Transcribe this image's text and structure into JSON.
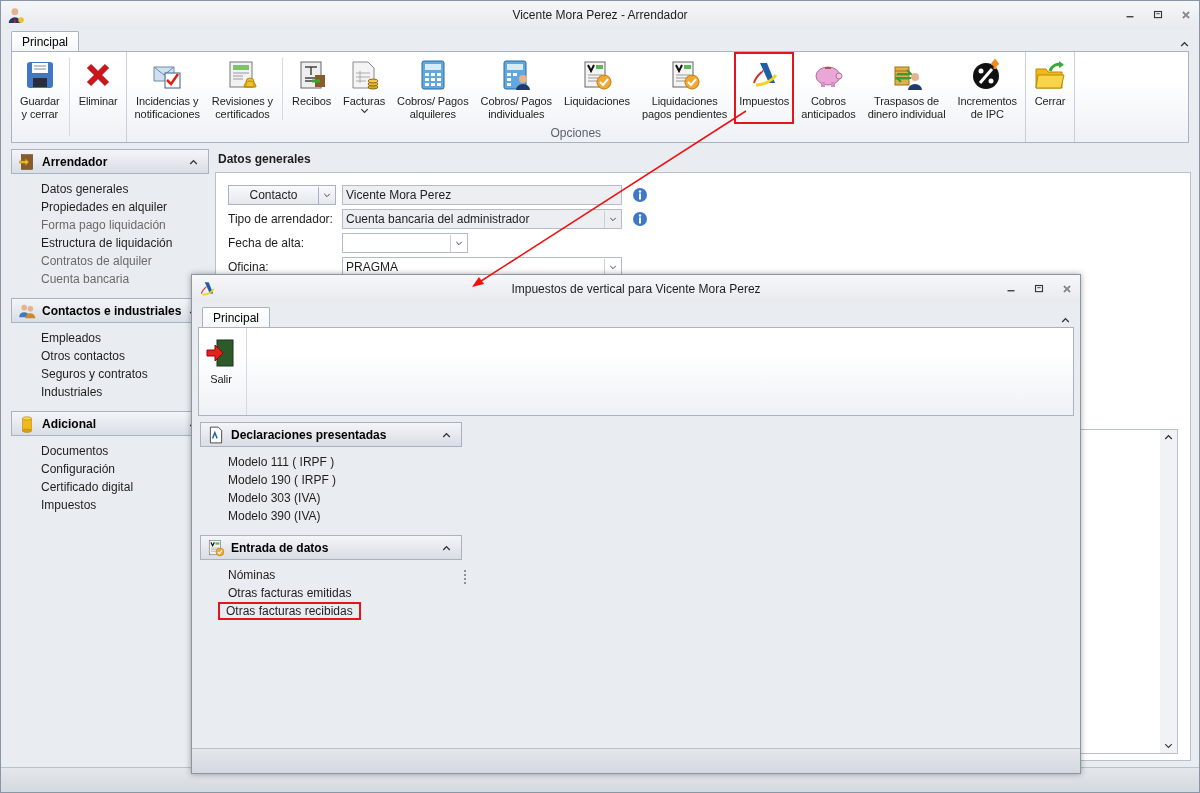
{
  "window": {
    "title": "Vicente Mora Perez - Arrendador"
  },
  "ribbon": {
    "tabs": [
      {
        "label": "Principal",
        "selected": true
      }
    ],
    "groups": [
      {
        "sets": [
          {
            "buttons": [
              {
                "label": "Guardar\ny cerrar",
                "kind": "button",
                "highlighted": false
              }
            ]
          },
          {
            "buttons": [
              {
                "label": "Eliminar",
                "kind": "button",
                "highlighted": false
              }
            ]
          }
        ]
      },
      {
        "label": "Opciones",
        "sets": [
          {
            "buttons": [
              {
                "label": "Incidencias y\nnotificaciones",
                "kind": "button",
                "highlighted": false
              },
              {
                "label": "Revisiones y\ncertificados",
                "kind": "button",
                "highlighted": false
              }
            ]
          },
          {
            "buttons": [
              {
                "label": "Recibos",
                "kind": "button",
                "highlighted": false
              },
              {
                "label": "Facturas",
                "kind": "dropdown",
                "highlighted": false
              },
              {
                "label": "Cobros/ Pagos\nalquileres",
                "kind": "button",
                "highlighted": false
              },
              {
                "label": "Cobros/ Pagos\nindividuales",
                "kind": "button",
                "highlighted": false
              },
              {
                "label": "Liquidaciones",
                "kind": "button",
                "highlighted": false
              },
              {
                "label": "Liquidaciones\npagos pendientes",
                "kind": "button",
                "highlighted": false
              },
              {
                "label": "Impuestos",
                "kind": "button",
                "highlighted": true
              },
              {
                "label": "Cobros\nanticipados",
                "kind": "button",
                "highlighted": false
              },
              {
                "label": "Traspasos de\ndinero individual",
                "kind": "button",
                "highlighted": false
              },
              {
                "label": "Incrementos\nde IPC",
                "kind": "button",
                "highlighted": false
              }
            ]
          }
        ]
      },
      {
        "sets": [
          {
            "buttons": [
              {
                "label": "Cerrar",
                "kind": "button",
                "highlighted": false
              }
            ]
          }
        ]
      }
    ]
  },
  "sidebar": {
    "groups": [
      {
        "title": "Arrendador",
        "expanded": true,
        "items": [
          {
            "label": "Datos generales",
            "disabled": false
          },
          {
            "label": "Propiedades en alquiler",
            "disabled": false
          },
          {
            "label": "Forma pago liquidación",
            "disabled": true
          },
          {
            "label": "Estructura de liquidación",
            "disabled": false
          },
          {
            "label": "Contratos de alquiler",
            "disabled": true
          },
          {
            "label": "Cuenta bancaria",
            "disabled": true
          }
        ]
      },
      {
        "title": "Contactos e industriales",
        "expanded": true,
        "items": [
          {
            "label": "Empleados",
            "disabled": false
          },
          {
            "label": "Otros contactos",
            "disabled": false
          },
          {
            "label": "Seguros y contratos",
            "disabled": false
          },
          {
            "label": "Industriales",
            "disabled": false
          }
        ]
      },
      {
        "title": "Adicional",
        "expanded": true,
        "items": [
          {
            "label": "Documentos",
            "disabled": false
          },
          {
            "label": "Configuración",
            "disabled": false
          },
          {
            "label": "Certificado digital",
            "disabled": false
          },
          {
            "label": "Impuestos",
            "disabled": false
          }
        ]
      }
    ]
  },
  "form": {
    "title": "Datos generales",
    "rows": [
      {
        "kind": "split",
        "button": "Contacto",
        "value": "Vicente Mora Perez",
        "disabled": true,
        "info": true
      },
      {
        "kind": "combo",
        "label": "Tipo de arrendador:",
        "value": "Cuenta bancaria del administrador",
        "disabled": true,
        "info": true
      },
      {
        "kind": "date",
        "label": "Fecha de alta:",
        "disabled": false,
        "info": false
      },
      {
        "kind": "combo",
        "label": "Oficina:",
        "value": "PRAGMA",
        "disabled": false,
        "info": false
      }
    ]
  },
  "dialog": {
    "title": "Impuestos de vertical para Vicente Mora Perez",
    "tabs": [
      {
        "label": "Principal",
        "selected": true
      }
    ],
    "buttons": [
      {
        "label": "Salir"
      }
    ],
    "groups": [
      {
        "title": "Declaraciones presentadas",
        "expanded": true,
        "items": [
          {
            "label": "Modelo 111 ( IRPF )",
            "highlighted": false
          },
          {
            "label": "Modelo 190 ( IRPF )",
            "highlighted": false
          },
          {
            "label": "Modelo 303 (IVA)",
            "highlighted": false
          },
          {
            "label": "Modelo 390 (IVA)",
            "highlighted": false
          }
        ]
      },
      {
        "title": "Entrada de datos",
        "expanded": true,
        "items": [
          {
            "label": "Nóminas",
            "highlighted": false
          },
          {
            "label": "Otras facturas emitidas",
            "highlighted": false
          },
          {
            "label": "Otras facturas recibidas",
            "highlighted": true
          }
        ]
      }
    ]
  }
}
